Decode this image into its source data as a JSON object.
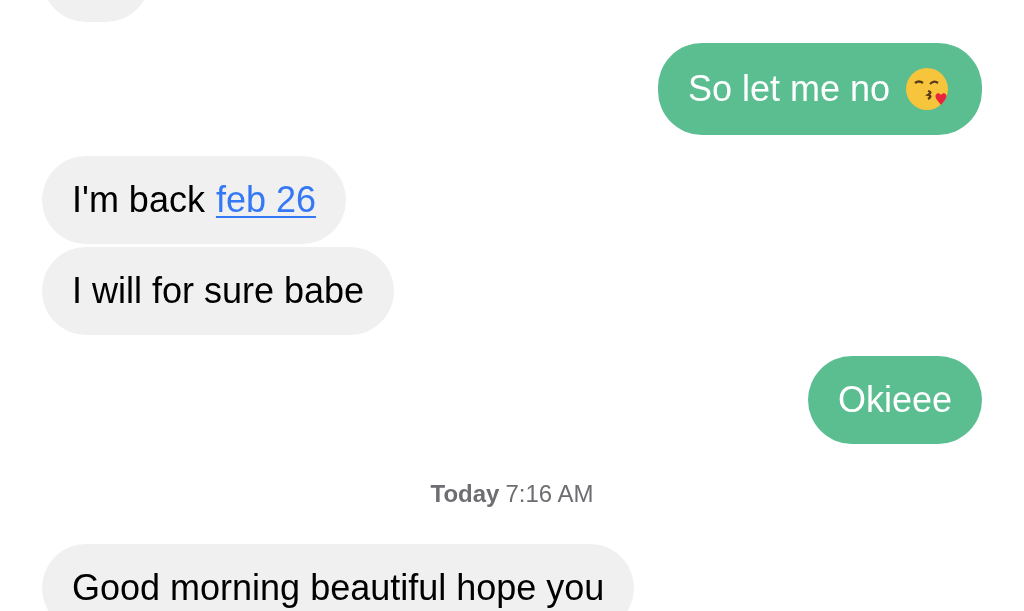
{
  "messages": [
    {
      "kind": "incoming"
    },
    {
      "kind": "outgoing",
      "text": "So let me no",
      "emoji": true
    },
    {
      "kind": "incoming",
      "text": "I'm back",
      "link": "feb 26"
    },
    {
      "kind": "incoming",
      "text": "I will for sure babe"
    },
    {
      "kind": "outgoing",
      "text": "Okieee"
    },
    {
      "kind": "timestamp",
      "day": "Today",
      "time": "7:16 AM"
    },
    {
      "kind": "incoming",
      "text": "Good morning beautiful hope you"
    }
  ]
}
